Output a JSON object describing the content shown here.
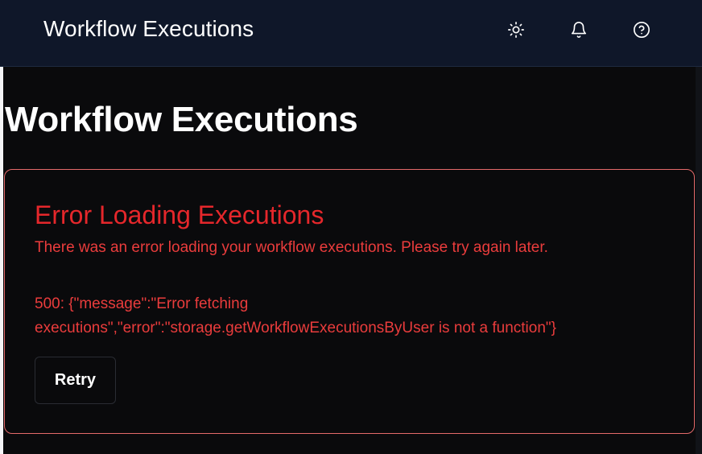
{
  "header": {
    "title": "Workflow Executions",
    "icons": [
      "sun-icon",
      "bell-icon",
      "help-circle-icon"
    ]
  },
  "main": {
    "title": "Workflow Executions"
  },
  "error_card": {
    "title": "Error Loading Executions",
    "description": "There was an error loading your workflow executions. Please try again later.",
    "error_line_1": "500: {\"message\":\"Error fetching",
    "error_line_2": "executions\",\"error\":\"storage.getWorkflowExecutionsByUser is not a function\"}",
    "retry_label": "Retry"
  },
  "colors": {
    "header_bg": "#0f1729",
    "page_bg": "#0a0a0c",
    "error_red": "#e5272b",
    "card_border": "#e46a6a"
  }
}
